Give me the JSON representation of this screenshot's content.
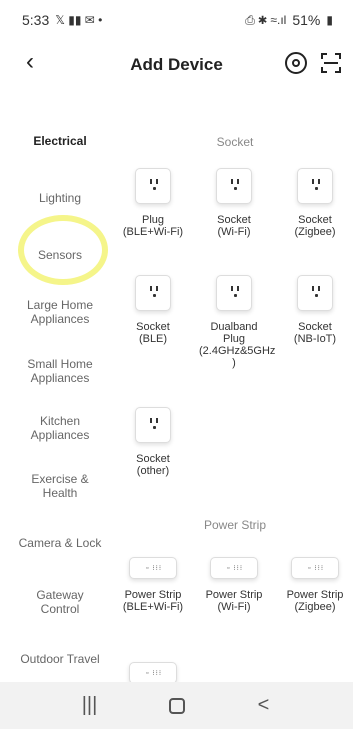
{
  "status_bar": {
    "time": "5:33",
    "left_icons": "𝕏 ▮▮ ✉ •",
    "right_icons": "⎙ ✱ ≈.ıl",
    "battery": "51%"
  },
  "header": {
    "back_icon": "back-chevron-icon",
    "title": "Add Device"
  },
  "sidebar": {
    "items": [
      {
        "label": "Electrical",
        "active": true
      },
      {
        "label": "Lighting"
      },
      {
        "label": "Sensors"
      },
      {
        "label": "Large Home\nAppliances"
      },
      {
        "label": "Small Home\nAppliances"
      },
      {
        "label": "Kitchen\nAppliances"
      },
      {
        "label": "Exercise &\nHealth"
      },
      {
        "label": "Camera & Lock"
      },
      {
        "label": "Gateway\nControl"
      },
      {
        "label": "Outdoor Travel"
      }
    ]
  },
  "sections": {
    "socket_title": "Socket",
    "power_strip_title": "Power Strip"
  },
  "socket_devices": [
    {
      "label": "Plug\n(BLE+Wi-Fi)"
    },
    {
      "label": "Socket\n(Wi-Fi)"
    },
    {
      "label": "Socket\n(Zigbee)"
    },
    {
      "label": "Socket\n(BLE)"
    },
    {
      "label": "Dualband\nPlug\n(2.4GHz&5GHz\n)"
    },
    {
      "label": "Socket\n(NB-IoT)"
    },
    {
      "label": "Socket\n(other)"
    }
  ],
  "power_strips": [
    {
      "label": "Power Strip\n(BLE+Wi-Fi)"
    },
    {
      "label": "Power Strip\n(Wi-Fi)"
    },
    {
      "label": "Power Strip\n(Zigbee)"
    }
  ],
  "nav": {
    "recents": "|||",
    "back": "<"
  },
  "strip_face_text": "▫ ⁝⁝⁝"
}
